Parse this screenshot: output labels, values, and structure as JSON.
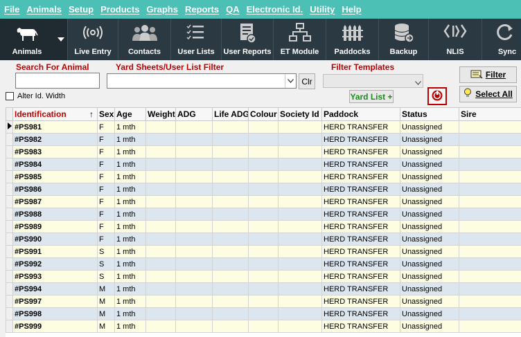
{
  "menu": [
    "File",
    "Animals",
    "Setup",
    "Products",
    "Graphs",
    "Reports",
    "QA",
    "Electronic Id.",
    "Utility",
    "Help"
  ],
  "toolbar": [
    {
      "label": "Animals",
      "icon": "cow-icon"
    },
    {
      "label": "Live Entry",
      "icon": "broadcast-icon"
    },
    {
      "label": "Contacts",
      "icon": "people-icon"
    },
    {
      "label": "User Lists",
      "icon": "checklist-icon"
    },
    {
      "label": "User Reports",
      "icon": "report-icon"
    },
    {
      "label": "ET Module",
      "icon": "hierarchy-icon"
    },
    {
      "label": "Paddocks",
      "icon": "fence-icon"
    },
    {
      "label": "Backup",
      "icon": "database-icon"
    },
    {
      "label": "NLIS",
      "icon": "nlis-icon"
    },
    {
      "label": "Sync",
      "icon": "sync-icon"
    }
  ],
  "filters": {
    "search_label": "Search For Animal",
    "search_value": "",
    "yard_label": "Yard Sheets/User List Filter",
    "yard_value": "",
    "clr_label": "Clr",
    "templates_label": "Filter Templates",
    "templates_value": "",
    "yard_list_label": "Yard List +",
    "alter_label": "Alter Id. Width",
    "filter_label": "Filter",
    "select_all_label": "Select All"
  },
  "grid": {
    "columns": [
      "Identification",
      "Sex",
      "Age",
      "Weight",
      "ADG",
      "Life ADG",
      "Colour",
      "Society Id",
      "Paddock",
      "Status",
      "Sire"
    ],
    "sort_indicator": "↑",
    "rows": [
      [
        "#PS981",
        "F",
        "1 mth",
        "",
        "",
        "",
        "",
        "",
        "HERD TRANSFER",
        "Unassigned",
        ""
      ],
      [
        "#PS982",
        "F",
        "1 mth",
        "",
        "",
        "",
        "",
        "",
        "HERD TRANSFER",
        "Unassigned",
        ""
      ],
      [
        "#PS983",
        "F",
        "1 mth",
        "",
        "",
        "",
        "",
        "",
        "HERD TRANSFER",
        "Unassigned",
        ""
      ],
      [
        "#PS984",
        "F",
        "1 mth",
        "",
        "",
        "",
        "",
        "",
        "HERD TRANSFER",
        "Unassigned",
        ""
      ],
      [
        "#PS985",
        "F",
        "1 mth",
        "",
        "",
        "",
        "",
        "",
        "HERD TRANSFER",
        "Unassigned",
        ""
      ],
      [
        "#PS986",
        "F",
        "1 mth",
        "",
        "",
        "",
        "",
        "",
        "HERD TRANSFER",
        "Unassigned",
        ""
      ],
      [
        "#PS987",
        "F",
        "1 mth",
        "",
        "",
        "",
        "",
        "",
        "HERD TRANSFER",
        "Unassigned",
        ""
      ],
      [
        "#PS988",
        "F",
        "1 mth",
        "",
        "",
        "",
        "",
        "",
        "HERD TRANSFER",
        "Unassigned",
        ""
      ],
      [
        "#PS989",
        "F",
        "1 mth",
        "",
        "",
        "",
        "",
        "",
        "HERD TRANSFER",
        "Unassigned",
        ""
      ],
      [
        "#PS990",
        "F",
        "1 mth",
        "",
        "",
        "",
        "",
        "",
        "HERD TRANSFER",
        "Unassigned",
        ""
      ],
      [
        "#PS991",
        "S",
        "1 mth",
        "",
        "",
        "",
        "",
        "",
        "HERD TRANSFER",
        "Unassigned",
        ""
      ],
      [
        "#PS992",
        "S",
        "1 mth",
        "",
        "",
        "",
        "",
        "",
        "HERD TRANSFER",
        "Unassigned",
        ""
      ],
      [
        "#PS993",
        "S",
        "1 mth",
        "",
        "",
        "",
        "",
        "",
        "HERD TRANSFER",
        "Unassigned",
        ""
      ],
      [
        "#PS994",
        "M",
        "1 mth",
        "",
        "",
        "",
        "",
        "",
        "HERD TRANSFER",
        "Unassigned",
        ""
      ],
      [
        "#PS997",
        "M",
        "1 mth",
        "",
        "",
        "",
        "",
        "",
        "HERD TRANSFER",
        "Unassigned",
        ""
      ],
      [
        "#PS998",
        "M",
        "1 mth",
        "",
        "",
        "",
        "",
        "",
        "HERD TRANSFER",
        "Unassigned",
        ""
      ],
      [
        "#PS999",
        "M",
        "1 mth",
        "",
        "",
        "",
        "",
        "",
        "HERD TRANSFER",
        "Unassigned",
        ""
      ]
    ]
  },
  "colors": {
    "menu_bg": "#4cc0b5",
    "toolbar_bg": "#2b3942",
    "label_red": "#c00000",
    "row_blue": "#dce6ee",
    "row_yellow": "#fdfde2",
    "yard_green": "#1a8a1a"
  }
}
